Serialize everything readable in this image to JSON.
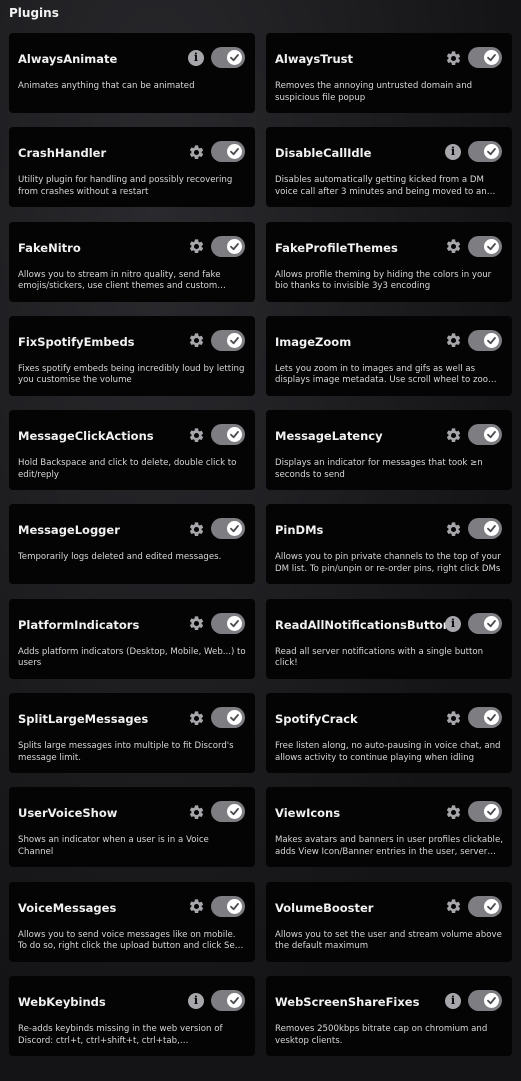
{
  "section": {
    "title": "Plugins"
  },
  "plugins": [
    {
      "name": "AlwaysAnimate",
      "description": "Animates anything that can be animated",
      "icon": "info-icon",
      "enabled": true
    },
    {
      "name": "AlwaysTrust",
      "description": "Removes the annoying untrusted domain and suspicious file popup",
      "icon": "gear-icon",
      "enabled": true
    },
    {
      "name": "CrashHandler",
      "description": "Utility plugin for handling and possibly recovering from crashes without a restart",
      "icon": "gear-icon",
      "enabled": true
    },
    {
      "name": "DisableCallIdle",
      "description": "Disables automatically getting kicked from a DM voice call after 3 minutes and being moved to an AFK voic…",
      "icon": "info-icon",
      "enabled": true
    },
    {
      "name": "FakeNitro",
      "description": "Allows you to stream in nitro quality, send fake emojis/stickers, use client themes and custom Disco…",
      "icon": "gear-icon",
      "enabled": true
    },
    {
      "name": "FakeProfileThemes",
      "description": "Allows profile theming by hiding the colors in your bio thanks to invisible 3y3 encoding",
      "icon": "gear-icon",
      "enabled": true
    },
    {
      "name": "FixSpotifyEmbeds",
      "description": "Fixes spotify embeds being incredibly loud by letting you customise the volume",
      "icon": "gear-icon",
      "enabled": true
    },
    {
      "name": "ImageZoom",
      "description": "Lets you zoom in to images and gifs as well as displays image metadata. Use scroll wheel to zoom in and shi…",
      "icon": "gear-icon",
      "enabled": true
    },
    {
      "name": "MessageClickActions",
      "description": "Hold Backspace and click to delete, double click to edit/reply",
      "icon": "gear-icon",
      "enabled": true
    },
    {
      "name": "MessageLatency",
      "description": "Displays an indicator for messages that took ≥n seconds to send",
      "icon": "gear-icon",
      "enabled": true
    },
    {
      "name": "MessageLogger",
      "description": "Temporarily logs deleted and edited messages.",
      "icon": "gear-icon",
      "enabled": true
    },
    {
      "name": "PinDMs",
      "description": "Allows you to pin private channels to the top of your DM list. To pin/unpin or re-order pins, right click DMs",
      "icon": "gear-icon",
      "enabled": true
    },
    {
      "name": "PlatformIndicators",
      "description": "Adds platform indicators (Desktop, Mobile, Web...) to users",
      "icon": "gear-icon",
      "enabled": true
    },
    {
      "name": "ReadAllNotificationsButton",
      "description": "Read all server notifications with a single button click!",
      "icon": "info-icon",
      "enabled": true
    },
    {
      "name": "SplitLargeMessages",
      "description": "Splits large messages into multiple to fit Discord's message limit.",
      "icon": "gear-icon",
      "enabled": true
    },
    {
      "name": "SpotifyCrack",
      "description": "Free listen along, no auto-pausing in voice chat, and allows activity to continue playing when idling",
      "icon": "gear-icon",
      "enabled": true
    },
    {
      "name": "UserVoiceShow",
      "description": "Shows an indicator when a user is in a Voice Channel",
      "icon": "gear-icon",
      "enabled": true
    },
    {
      "name": "ViewIcons",
      "description": "Makes avatars and banners in user profiles clickable, adds View Icon/Banner entries in the user, server an…",
      "icon": "gear-icon",
      "enabled": true
    },
    {
      "name": "VoiceMessages",
      "description": "Allows you to send voice messages like on mobile. To do so, right click the upload button and click Send V…",
      "icon": "gear-icon",
      "enabled": true
    },
    {
      "name": "VolumeBooster",
      "description": "Allows you to set the user and stream volume above the default maximum",
      "icon": "gear-icon",
      "enabled": true
    },
    {
      "name": "WebKeybinds",
      "description": "Re-adds keybinds missing in the web version of Discord: ctrl+t, ctrl+shift+t, ctrl+tab, ctrl+shift+tab,…",
      "icon": "info-icon",
      "enabled": true
    },
    {
      "name": "WebScreenShareFixes",
      "description": "Removes 2500kbps bitrate cap on chromium and vesktop clients.",
      "icon": "info-icon",
      "enabled": true
    }
  ],
  "colors": {
    "card_bg": "#040405",
    "toggle_on": "#7d7d82",
    "icon_gray": "#a7a7ab"
  }
}
